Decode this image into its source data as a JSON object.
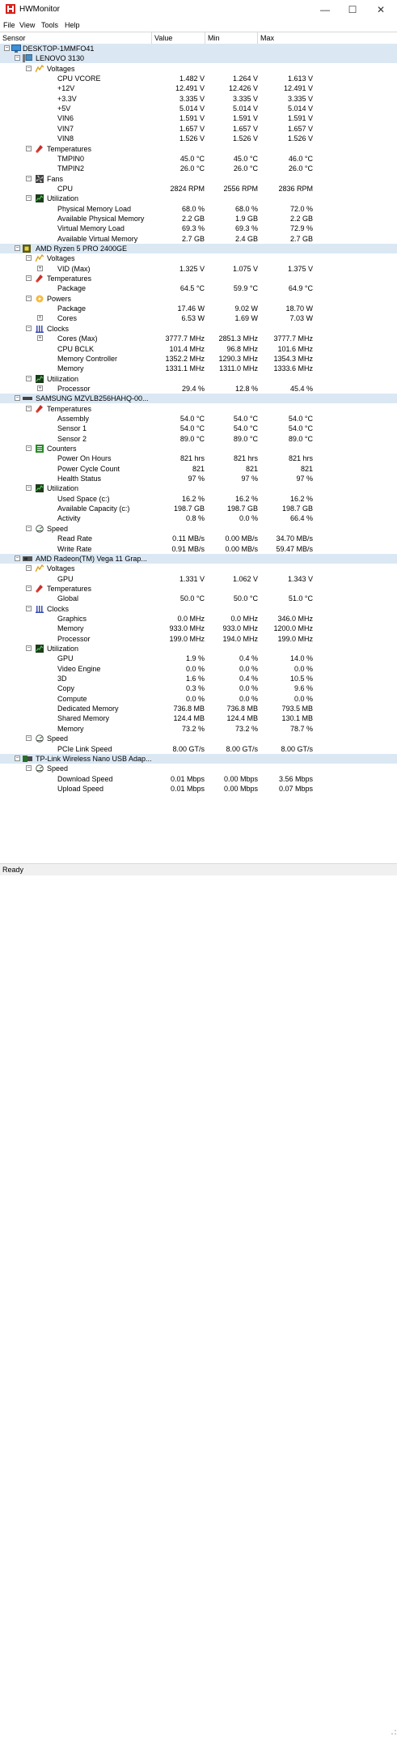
{
  "window": {
    "title": "HWMonitor",
    "minimize": "—",
    "maximize": "☐",
    "close": "✕"
  },
  "menu": [
    "File",
    "View",
    "Tools",
    "Help"
  ],
  "columns": {
    "sensor": "Sensor",
    "value": "Value",
    "min": "Min",
    "max": "Max"
  },
  "status": "Ready",
  "colors": {
    "selected_row": "#dbe8f4",
    "app_icon": "#d8211b"
  },
  "tree": [
    {
      "lvl": 0,
      "icon": "monitor-icon",
      "label": "DESKTOP-1MMFO41",
      "hl": true
    },
    {
      "lvl": 1,
      "icon": "computer-icon",
      "label": "LENOVO 3130",
      "hl": true
    },
    {
      "lvl": 2,
      "icon": "voltage-icon",
      "label": "Voltages"
    },
    {
      "lvl": 3,
      "label": "CPU VCORE",
      "v": "1.482 V",
      "mn": "1.264 V",
      "mx": "1.613 V"
    },
    {
      "lvl": 3,
      "label": "+12V",
      "v": "12.491 V",
      "mn": "12.426 V",
      "mx": "12.491 V"
    },
    {
      "lvl": 3,
      "label": "+3.3V",
      "v": "3.335 V",
      "mn": "3.335 V",
      "mx": "3.335 V"
    },
    {
      "lvl": 3,
      "label": "+5V",
      "v": "5.014 V",
      "mn": "5.014 V",
      "mx": "5.014 V"
    },
    {
      "lvl": 3,
      "label": "VIN6",
      "v": "1.591 V",
      "mn": "1.591 V",
      "mx": "1.591 V"
    },
    {
      "lvl": 3,
      "label": "VIN7",
      "v": "1.657 V",
      "mn": "1.657 V",
      "mx": "1.657 V"
    },
    {
      "lvl": 3,
      "label": "VIN8",
      "v": "1.526 V",
      "mn": "1.526 V",
      "mx": "1.526 V"
    },
    {
      "lvl": 2,
      "icon": "thermometer-icon",
      "label": "Temperatures"
    },
    {
      "lvl": 3,
      "label": "TMPIN0",
      "v": "45.0 °C",
      "mn": "45.0 °C",
      "mx": "46.0 °C"
    },
    {
      "lvl": 3,
      "label": "TMPIN2",
      "v": "26.0 °C",
      "mn": "26.0 °C",
      "mx": "26.0 °C"
    },
    {
      "lvl": 2,
      "icon": "fan-icon",
      "label": "Fans"
    },
    {
      "lvl": 3,
      "label": "CPU",
      "v": "2824 RPM",
      "mn": "2556 RPM",
      "mx": "2836 RPM"
    },
    {
      "lvl": 2,
      "icon": "utilization-icon",
      "label": "Utilization"
    },
    {
      "lvl": 3,
      "label": "Physical Memory Load",
      "v": "68.0 %",
      "mn": "68.0 %",
      "mx": "72.0 %"
    },
    {
      "lvl": 3,
      "label": "Available Physical Memory",
      "v": "2.2 GB",
      "mn": "1.9 GB",
      "mx": "2.2 GB"
    },
    {
      "lvl": 3,
      "label": "Virtual Memory Load",
      "v": "69.3 %",
      "mn": "69.3 %",
      "mx": "72.9 %"
    },
    {
      "lvl": 3,
      "label": "Available Virtual Memory",
      "v": "2.7 GB",
      "mn": "2.4 GB",
      "mx": "2.7 GB"
    },
    {
      "lvl": 1,
      "icon": "cpu-icon",
      "label": "AMD Ryzen 5 PRO 2400GE",
      "hl": true
    },
    {
      "lvl": 2,
      "icon": "voltage-icon",
      "label": "Voltages"
    },
    {
      "lvl": 3,
      "exp": "+",
      "label": "VID (Max)",
      "v": "1.325 V",
      "mn": "1.075 V",
      "mx": "1.375 V"
    },
    {
      "lvl": 2,
      "icon": "thermometer-icon",
      "label": "Temperatures"
    },
    {
      "lvl": 3,
      "label": "Package",
      "v": "64.5 °C",
      "mn": "59.9 °C",
      "mx": "64.9 °C"
    },
    {
      "lvl": 2,
      "icon": "power-icon",
      "label": "Powers"
    },
    {
      "lvl": 3,
      "label": "Package",
      "v": "17.46 W",
      "mn": "9.02 W",
      "mx": "18.70 W"
    },
    {
      "lvl": 3,
      "exp": "+",
      "label": "Cores",
      "v": "6.53 W",
      "mn": "1.69 W",
      "mx": "7.03 W"
    },
    {
      "lvl": 2,
      "icon": "clock-icon",
      "label": "Clocks"
    },
    {
      "lvl": 3,
      "exp": "+",
      "label": "Cores (Max)",
      "v": "3777.7 MHz",
      "mn": "2851.3 MHz",
      "mx": "3777.7 MHz"
    },
    {
      "lvl": 3,
      "label": "CPU BCLK",
      "v": "101.4 MHz",
      "mn": "96.8 MHz",
      "mx": "101.6 MHz"
    },
    {
      "lvl": 3,
      "label": "Memory Controller",
      "v": "1352.2 MHz",
      "mn": "1290.3 MHz",
      "mx": "1354.3 MHz"
    },
    {
      "lvl": 3,
      "label": "Memory",
      "v": "1331.1 MHz",
      "mn": "1311.0 MHz",
      "mx": "1333.6 MHz"
    },
    {
      "lvl": 2,
      "icon": "utilization-icon",
      "label": "Utilization"
    },
    {
      "lvl": 3,
      "exp": "+",
      "label": "Processor",
      "v": "29.4 %",
      "mn": "12.8 %",
      "mx": "45.4 %"
    },
    {
      "lvl": 1,
      "icon": "drive-icon",
      "label": "SAMSUNG MZVLB256HAHQ-00...",
      "hl": true
    },
    {
      "lvl": 2,
      "icon": "thermometer-icon",
      "label": "Temperatures"
    },
    {
      "lvl": 3,
      "label": "Assembly",
      "v": "54.0 °C",
      "mn": "54.0 °C",
      "mx": "54.0 °C"
    },
    {
      "lvl": 3,
      "label": "Sensor 1",
      "v": "54.0 °C",
      "mn": "54.0 °C",
      "mx": "54.0 °C"
    },
    {
      "lvl": 3,
      "label": "Sensor 2",
      "v": "89.0 °C",
      "mn": "89.0 °C",
      "mx": "89.0 °C"
    },
    {
      "lvl": 2,
      "icon": "counter-icon",
      "label": "Counters"
    },
    {
      "lvl": 3,
      "label": "Power On Hours",
      "v": "821 hrs",
      "mn": "821 hrs",
      "mx": "821 hrs"
    },
    {
      "lvl": 3,
      "label": "Power Cycle Count",
      "v": "821",
      "mn": "821",
      "mx": "821"
    },
    {
      "lvl": 3,
      "label": "Health Status",
      "v": "97 %",
      "mn": "97 %",
      "mx": "97 %"
    },
    {
      "lvl": 2,
      "icon": "utilization-icon",
      "label": "Utilization"
    },
    {
      "lvl": 3,
      "label": "Used Space (c:)",
      "v": "16.2 %",
      "mn": "16.2 %",
      "mx": "16.2 %"
    },
    {
      "lvl": 3,
      "label": "Available Capacity (c:)",
      "v": "198.7 GB",
      "mn": "198.7 GB",
      "mx": "198.7 GB"
    },
    {
      "lvl": 3,
      "label": "Activity",
      "v": "0.8 %",
      "mn": "0.0 %",
      "mx": "66.4 %"
    },
    {
      "lvl": 2,
      "icon": "speed-icon",
      "label": "Speed"
    },
    {
      "lvl": 3,
      "label": "Read Rate",
      "v": "0.11 MB/s",
      "mn": "0.00 MB/s",
      "mx": "34.70 MB/s"
    },
    {
      "lvl": 3,
      "label": "Write Rate",
      "v": "0.91 MB/s",
      "mn": "0.00 MB/s",
      "mx": "59.47 MB/s"
    },
    {
      "lvl": 1,
      "icon": "gpu-icon",
      "label": "AMD Radeon(TM) Vega 11 Grap...",
      "hl": true
    },
    {
      "lvl": 2,
      "icon": "voltage-icon",
      "label": "Voltages"
    },
    {
      "lvl": 3,
      "label": "GPU",
      "v": "1.331 V",
      "mn": "1.062 V",
      "mx": "1.343 V"
    },
    {
      "lvl": 2,
      "icon": "thermometer-icon",
      "label": "Temperatures"
    },
    {
      "lvl": 3,
      "label": "Global",
      "v": "50.0 °C",
      "mn": "50.0 °C",
      "mx": "51.0 °C"
    },
    {
      "lvl": 2,
      "icon": "clock-icon",
      "label": "Clocks"
    },
    {
      "lvl": 3,
      "label": "Graphics",
      "v": "0.0 MHz",
      "mn": "0.0 MHz",
      "mx": "346.0 MHz"
    },
    {
      "lvl": 3,
      "label": "Memory",
      "v": "933.0 MHz",
      "mn": "933.0 MHz",
      "mx": "1200.0 MHz"
    },
    {
      "lvl": 3,
      "label": "Processor",
      "v": "199.0 MHz",
      "mn": "194.0 MHz",
      "mx": "199.0 MHz"
    },
    {
      "lvl": 2,
      "icon": "utilization-icon",
      "label": "Utilization"
    },
    {
      "lvl": 3,
      "label": "GPU",
      "v": "1.9 %",
      "mn": "0.4 %",
      "mx": "14.0 %"
    },
    {
      "lvl": 3,
      "label": "Video Engine",
      "v": "0.0 %",
      "mn": "0.0 %",
      "mx": "0.0 %"
    },
    {
      "lvl": 3,
      "label": "3D",
      "v": "1.6 %",
      "mn": "0.4 %",
      "mx": "10.5 %"
    },
    {
      "lvl": 3,
      "label": "Copy",
      "v": "0.3 %",
      "mn": "0.0 %",
      "mx": "9.6 %"
    },
    {
      "lvl": 3,
      "label": "Compute",
      "v": "0.0 %",
      "mn": "0.0 %",
      "mx": "0.0 %"
    },
    {
      "lvl": 3,
      "label": "Dedicated Memory",
      "v": "736.8 MB",
      "mn": "736.8 MB",
      "mx": "793.5 MB"
    },
    {
      "lvl": 3,
      "label": "Shared Memory",
      "v": "124.4 MB",
      "mn": "124.4 MB",
      "mx": "130.1 MB"
    },
    {
      "lvl": 3,
      "label": "Memory",
      "v": "73.2 %",
      "mn": "73.2 %",
      "mx": "78.7 %"
    },
    {
      "lvl": 2,
      "icon": "speed-icon",
      "label": "Speed"
    },
    {
      "lvl": 3,
      "label": "PCIe Link Speed",
      "v": "8.00 GT/s",
      "mn": "8.00 GT/s",
      "mx": "8.00 GT/s"
    },
    {
      "lvl": 1,
      "icon": "network-icon",
      "label": "TP-Link Wireless Nano USB Adap...",
      "hl": true
    },
    {
      "lvl": 2,
      "icon": "speed-icon",
      "label": "Speed"
    },
    {
      "lvl": 3,
      "label": "Download Speed",
      "v": "0.01 Mbps",
      "mn": "0.00 Mbps",
      "mx": "3.56 Mbps"
    },
    {
      "lvl": 3,
      "label": "Upload Speed",
      "v": "0.01 Mbps",
      "mn": "0.00 Mbps",
      "mx": "0.07 Mbps"
    }
  ]
}
